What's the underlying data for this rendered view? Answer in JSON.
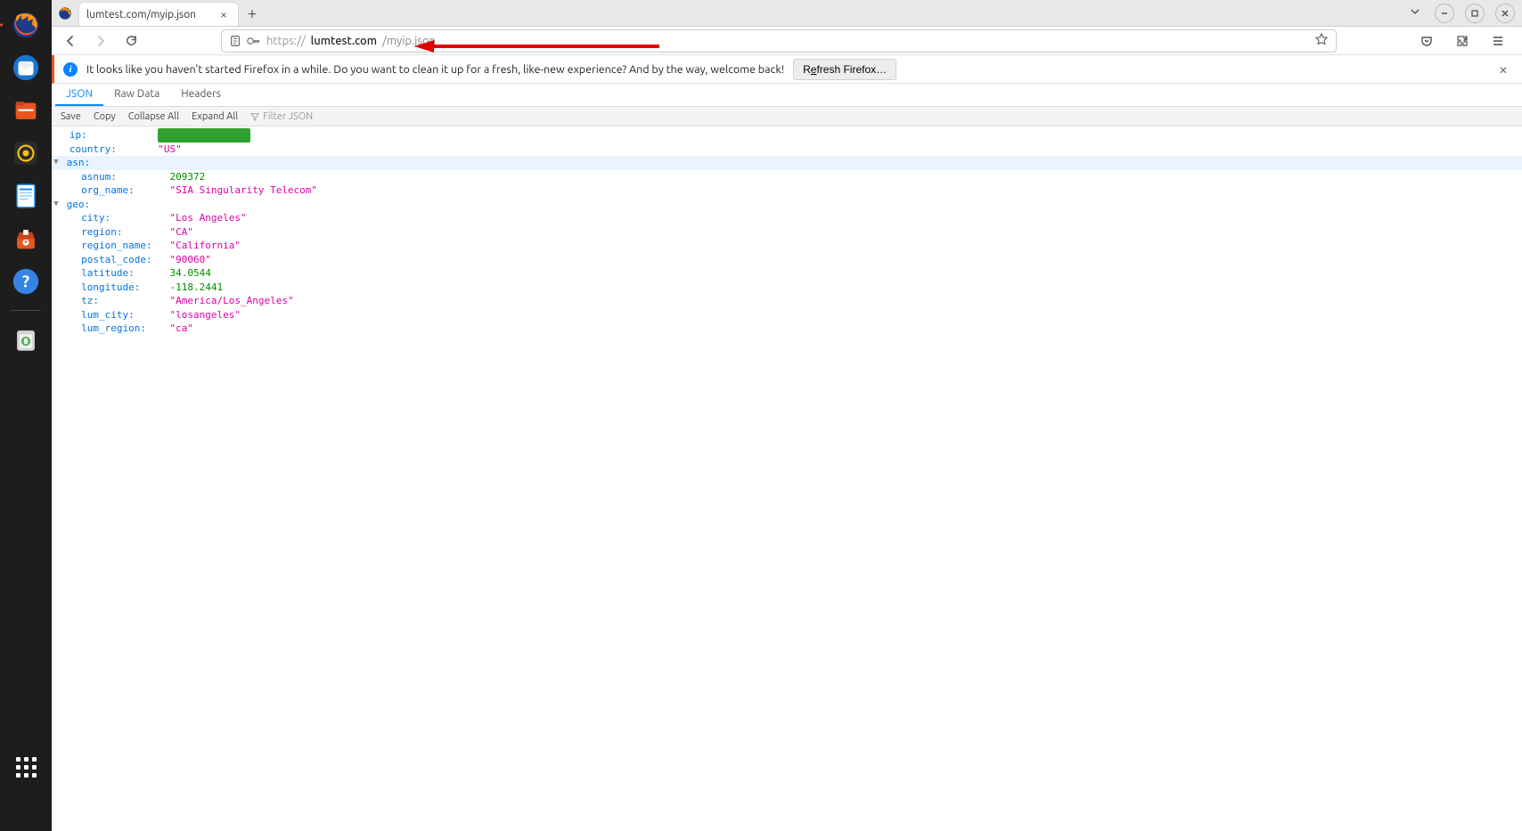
{
  "tab": {
    "title": "lumtest.com/myip.json"
  },
  "url": {
    "protocol": "https://",
    "host": "lumtest.com",
    "path": "/myip.json"
  },
  "notification": {
    "text": "It looks like you haven't started Firefox in a while. Do you want to clean it up for a fresh, like-new experience? And by the way, welcome back!",
    "button_prefix": "R",
    "button_accel": "e",
    "button_suffix": "fresh Firefox…"
  },
  "viewer_tabs": {
    "json": "JSON",
    "raw": "Raw Data",
    "headers": "Headers"
  },
  "viewer_toolbar": {
    "save": "Save",
    "copy": "Copy",
    "collapse": "Collapse All",
    "expand": "Expand All",
    "filter_placeholder": "Filter JSON"
  },
  "json": {
    "ip_key": "ip",
    "ip_val": "\"███.███.█.███\"",
    "country_key": "country",
    "country_val": "\"US\"",
    "asn_key": "asn",
    "asnum_key": "asnum",
    "asnum_val": "209372",
    "orgname_key": "org_name",
    "orgname_val": "\"SIA Singularity Telecom\"",
    "geo_key": "geo",
    "city_key": "city",
    "city_val": "\"Los Angeles\"",
    "region_key": "region",
    "region_val": "\"CA\"",
    "regionname_key": "region_name",
    "regionname_val": "\"California\"",
    "postal_key": "postal_code",
    "postal_val": "\"90060\"",
    "lat_key": "latitude",
    "lat_val": "34.0544",
    "lon_key": "longitude",
    "lon_val": "-118.2441",
    "tz_key": "tz",
    "tz_val": "\"America/Los_Angeles\"",
    "lumcity_key": "lum_city",
    "lumcity_val": "\"losangeles\"",
    "lumregion_key": "lum_region",
    "lumregion_val": "\"ca\""
  }
}
